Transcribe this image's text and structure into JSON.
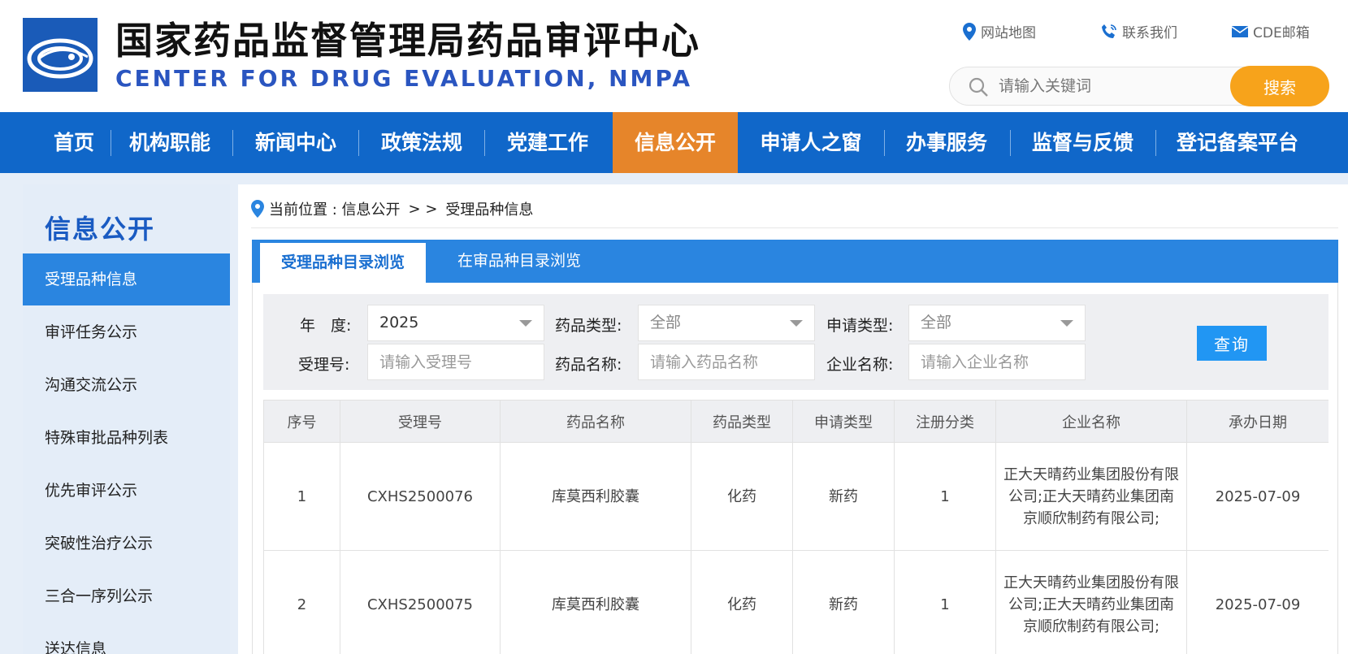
{
  "header": {
    "title_cn": "国家药品监督管理局药品审评中心",
    "title_en": "CENTER FOR DRUG EVALUATION, NMPA",
    "links": [
      {
        "label": "网站地图",
        "icon": "map-pin-icon"
      },
      {
        "label": "联系我们",
        "icon": "phone-icon"
      },
      {
        "label": "CDE邮箱",
        "icon": "mail-icon"
      }
    ],
    "search": {
      "placeholder": "请输入关键词",
      "button": "搜索"
    },
    "accent_color": "#f7a31b"
  },
  "nav": {
    "items": [
      "首页",
      "机构职能",
      "新闻中心",
      "政策法规",
      "党建工作",
      "信息公开",
      "申请人之窗",
      "办事服务",
      "监督与反馈",
      "登记备案平台"
    ],
    "active": "信息公开",
    "bg_color": "#1067c9",
    "active_color": "#e6852a"
  },
  "sidebar": {
    "title": "信息公开",
    "items": [
      "受理品种信息",
      "审评任务公示",
      "沟通交流公示",
      "特殊审批品种列表",
      "优先审评公示",
      "突破性治疗公示",
      "三合一序列公示",
      "送达信息"
    ],
    "active": "受理品种信息"
  },
  "breadcrumb": {
    "prefix": "当前位置 : 信息公开",
    "sep": "> >",
    "current": "受理品种信息"
  },
  "tabs": [
    {
      "label": "受理品种目录浏览",
      "active": true
    },
    {
      "label": "在审品种目录浏览",
      "active": false
    }
  ],
  "filter": {
    "year_label": "年　度:",
    "year_value": "2025",
    "drug_type_label": "药品类型:",
    "drug_type_value": "全部",
    "apply_type_label": "申请类型:",
    "apply_type_value": "全部",
    "accept_no_label": "受理号:",
    "accept_no_placeholder": "请输入受理号",
    "drug_name_label": "药品名称:",
    "drug_name_placeholder": "请输入药品名称",
    "company_label": "企业名称:",
    "company_placeholder": "请输入企业名称",
    "query_button": "查询"
  },
  "table": {
    "columns": [
      "序号",
      "受理号",
      "药品名称",
      "药品类型",
      "申请类型",
      "注册分类",
      "企业名称",
      "承办日期"
    ],
    "rows": [
      [
        "1",
        "CXHS2500076",
        "库莫西利胶囊",
        "化药",
        "新药",
        "1",
        "正大天晴药业集团股份有限公司;正大天晴药业集团南京顺欣制药有限公司;",
        "2025-07-09"
      ],
      [
        "2",
        "CXHS2500075",
        "库莫西利胶囊",
        "化药",
        "新药",
        "1",
        "正大天晴药业集团股份有限公司;正大天晴药业集团南京顺欣制药有限公司;",
        "2025-07-09"
      ]
    ]
  }
}
